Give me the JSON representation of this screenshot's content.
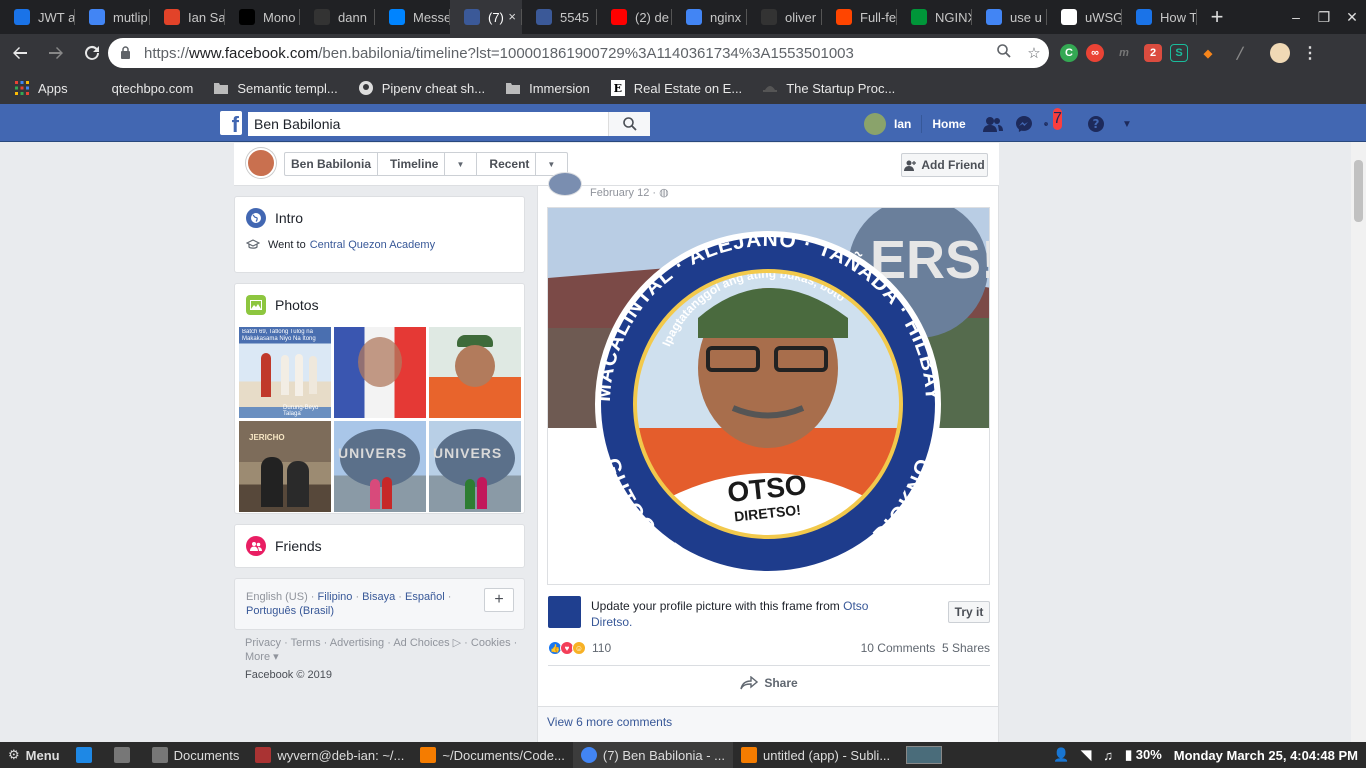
{
  "tabs": [
    {
      "label": "JWT a",
      "icon": "wave-icon",
      "color": "#1a73e8"
    },
    {
      "label": "mutlip",
      "icon": "google-icon",
      "color": "#4285f4"
    },
    {
      "label": "Ian Sa",
      "icon": "gitlab-icon",
      "color": "#e24329"
    },
    {
      "label": "Mono",
      "icon": "medium-icon",
      "color": "#000000"
    },
    {
      "label": "dann",
      "icon": "github-icon",
      "color": "#333333"
    },
    {
      "label": "Messe",
      "icon": "messenger-icon",
      "color": "#0084ff"
    },
    {
      "label": "(7)",
      "icon": "facebook-icon",
      "color": "#3b5998"
    },
    {
      "label": "5545",
      "icon": "facebook-icon",
      "color": "#3b5998"
    },
    {
      "label": "(2) de",
      "icon": "youtube-icon",
      "color": "#ff0000"
    },
    {
      "label": "nginx",
      "icon": "google-icon",
      "color": "#4285f4"
    },
    {
      "label": "oliver",
      "icon": "github-icon",
      "color": "#333333"
    },
    {
      "label": "Full-fe",
      "icon": "reddit-icon",
      "color": "#ff4500"
    },
    {
      "label": "NGINX",
      "icon": "nginx-icon",
      "color": "#009639"
    },
    {
      "label": "use u",
      "icon": "google-icon",
      "color": "#4285f4"
    },
    {
      "label": "uWSG",
      "icon": "uwsgi-icon",
      "color": "#ffffff"
    },
    {
      "label": "How T",
      "icon": "sync-icon",
      "color": "#1a73e8"
    }
  ],
  "tab_close": "×",
  "new_tab": "+",
  "window_controls": [
    "–",
    "❐",
    "✕"
  ],
  "address": {
    "prefix": "https://",
    "host": "www.facebook.com",
    "path": "/ben.babilonia/timeline?lst=100001861900729%3A1140361734%3A1553501003"
  },
  "bookmarks": [
    {
      "label": "Apps",
      "icon": "apps-grid-icon"
    },
    {
      "label": "qtechbpo.com",
      "icon": "blank-icon"
    },
    {
      "label": "Semantic templ...",
      "icon": "folder-icon"
    },
    {
      "label": "Pipenv cheat sh...",
      "icon": "github-icon"
    },
    {
      "label": "Immersion",
      "icon": "folder-icon"
    },
    {
      "label": "Real Estate on E...",
      "icon": "e-icon"
    },
    {
      "label": "The Startup Proc...",
      "icon": "hat-icon"
    }
  ],
  "fb": {
    "search_value": "Ben Babilonia",
    "user": "Ian",
    "home": "Home",
    "notif_count": "7"
  },
  "profile": {
    "name": "Ben Babilonia",
    "timeline": "Timeline",
    "recent": "Recent",
    "add_friend": "Add Friend"
  },
  "intro": {
    "title": "Intro",
    "went_to": "Went to",
    "school": "Central Quezon Academy"
  },
  "photos_title": "Photos",
  "friends_title": "Friends",
  "languages": {
    "current": "English (US)",
    "others": [
      "Filipino",
      "Bisaya",
      "Español",
      "Português (Brasil)"
    ]
  },
  "footer": {
    "links": "Privacy · Terms · Advertising · Ad Choices ▷ · Cookies · More ▾",
    "copyright": "Facebook © 2019"
  },
  "post": {
    "date": "February 12 · ",
    "frame_text": "Update your profile picture with this frame from ",
    "frame_link": "Otso Diretso.",
    "try_it": "Try it",
    "reaction_count": "110",
    "comments": "10 Comments",
    "shares": "5 Shares",
    "share_button": "Share",
    "view_more": "View 6 more comments"
  },
  "image_text": {
    "ring_top": "MACALINTAL · ALEJANO · TAÑADA · HILBAY",
    "ring_bottom": "GUTOC · ROXAS · AQUINO · DIOKNO",
    "slogan": "Ipagtatanggol ang ating bukas, boto",
    "logo1": "OTSO",
    "logo2": "DIRETSO!",
    "bg_sign": "ERS!",
    "thumb_sign": "UNIVERS"
  },
  "photo_captions": {
    "p1": "Batch 69, Tatlong Tulog na Makakasama Niyo Na Itong mga...",
    "p1_bottom": "Durung-Beyo Talaga",
    "p4": "JERICHO"
  },
  "taskbar": {
    "menu": "Menu",
    "items": [
      "Documents",
      "wyvern@deb-ian: ~/...",
      "~/Documents/Code...",
      "(7) Ben Babilonia - ...",
      "untitled (app) - Subli..."
    ],
    "battery": "30%",
    "clock": "Monday March 25,  4:04:48 PM"
  }
}
